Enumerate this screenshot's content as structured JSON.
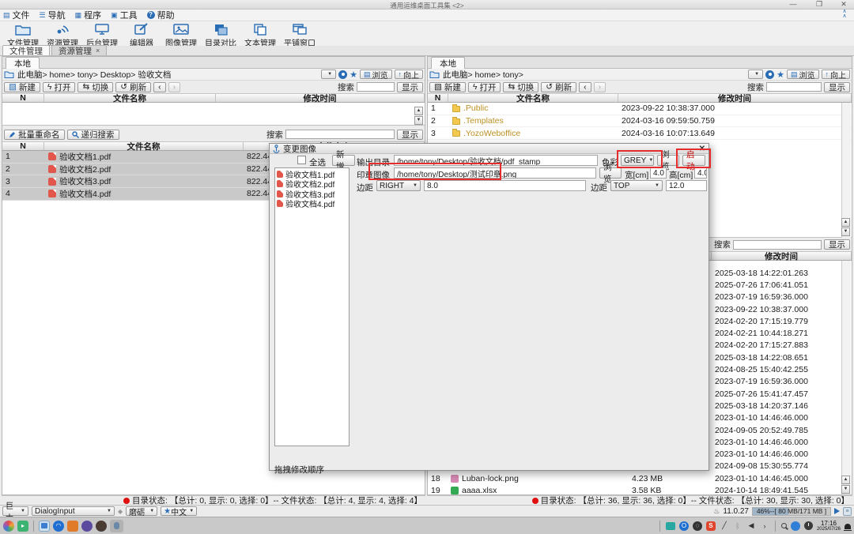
{
  "window": {
    "title": "通用运维桌面工具集 <2>"
  },
  "menu": {
    "file": "文件",
    "nav": "导航",
    "program": "程序",
    "tools": "工具",
    "help": "帮助"
  },
  "main_toolbar": {
    "file_mgmt": "文件管理",
    "resource_mgmt": "资源管理",
    "backend_mgmt": "后台管理",
    "editor": "编辑器",
    "image_mgmt": "图像管理",
    "dir_compare": "目录对比",
    "text_mgmt": "文本管理",
    "tile_windows": "平铺窗口"
  },
  "tabs": {
    "file_mgmt": "文件管理",
    "resource_mgmt": "资源管理"
  },
  "common": {
    "local_tab": "本地",
    "new": "新建",
    "open": "打开",
    "switch": "切换",
    "refresh": "刷新",
    "browse": "浏览",
    "up": "向上",
    "search": "搜索",
    "show": "显示",
    "col_n": "N",
    "col_name": "文件名称",
    "col_mtime": "修改时间",
    "col_size": "文件大小"
  },
  "left_pane": {
    "breadcrumb": "此电脑> home> tony> Desktop> 验收文档",
    "batch_rename": "批量重命名",
    "recursive_search": "递归搜索",
    "files": [
      {
        "n": "1",
        "name": "验收文档1.pdf",
        "size": "822.44 KB",
        "icon": "pdf"
      },
      {
        "n": "2",
        "name": "验收文档2.pdf",
        "size": "822.44 KB",
        "icon": "pdf"
      },
      {
        "n": "3",
        "name": "验收文档3.pdf",
        "size": "822.44 KB",
        "icon": "pdf"
      },
      {
        "n": "4",
        "name": "验收文档4.pdf",
        "size": "822.44 KB",
        "icon": "pdf"
      }
    ],
    "status": "目录状态: 【总计: 0, 显示: 0, 选择: 0】-- 文件状态: 【总计: 4, 显示: 4, 选择: 4】"
  },
  "right_pane": {
    "breadcrumb": "此电脑> home> tony>",
    "folders": [
      {
        "n": "1",
        "name": ".Public",
        "time": "2023-09-22 10:38:37.000",
        "icon": "folder"
      },
      {
        "n": "2",
        "name": ".Templates",
        "time": "2024-03-16 09:59:50.759",
        "icon": "folder"
      },
      {
        "n": "3",
        "name": ".YozoWeboffice",
        "time": "2024-03-16 10:07:13.649",
        "icon": "folder"
      }
    ],
    "bottom_rows": [
      {
        "time": "2025-03-18 14:22:01.263"
      },
      {
        "time": "2025-07-26 17:06:41.051"
      },
      {
        "time": "2023-07-19 16:59:36.000"
      },
      {
        "time": "2023-09-22 10:38:37.000"
      },
      {
        "time": "2024-02-20 17:15:19.779"
      },
      {
        "time": "2024-02-21 10:44:18.271"
      },
      {
        "time": "2024-02-20 17:15:27.883"
      },
      {
        "time": "2025-03-18 14:22:08.651"
      },
      {
        "time": "2024-08-25 15:40:42.255"
      },
      {
        "time": "2023-07-19 16:59:36.000"
      },
      {
        "time": "2025-07-26 15:41:47.457"
      },
      {
        "time": "2025-03-18 14:20:37.146"
      },
      {
        "time": "2023-01-10 14:46:46.000"
      },
      {
        "time": "2024-09-05 20:52:49.785"
      },
      {
        "time": "2023-01-10 14:46:46.000"
      },
      {
        "time": "2023-01-10 14:46:46.000"
      },
      {
        "time": "2024-09-08 15:30:55.774"
      },
      {
        "n": "18",
        "name": "Luban-lock.png",
        "size": "4.23 MB",
        "time": "2023-01-10 14:46:45.000",
        "icon": "png"
      },
      {
        "n": "19",
        "name": "aaaa.xlsx",
        "size": "3.58 KB",
        "time": "2024-10-14 18:49:41.545",
        "icon": "xlsx"
      }
    ],
    "status": "目录状态: 【总计: 36, 显示: 36, 选择: 0】-- 文件状态: 【总计: 30, 显示: 30, 选择: 0】"
  },
  "dialog": {
    "title": "变更图像",
    "select_all": "全选",
    "add": "新增",
    "files": [
      "验收文档1.pdf",
      "验收文档2.pdf",
      "验收文档3.pdf",
      "验收文档4.pdf"
    ],
    "output_dir_label": "输出目录",
    "output_dir": "/home/tony/Desktop/验收文档/pdf_stamp",
    "color_label": "色彩",
    "color_value": "GREY",
    "browse": "浏览",
    "start": "启动",
    "stamp_label": "印章图像",
    "stamp_path": "/home/tony/Desktop/测试印章.png",
    "width_label": "宽[cm]",
    "width_value": "4.0",
    "height_label": "高[cm]",
    "height_value": "4.0",
    "margin_label1": "边距",
    "margin_side1": "RIGHT",
    "margin_value1": "8.0",
    "margin_label2": "边距",
    "margin_side2": "TOP",
    "margin_value2": "12.0",
    "drag_hint": "拖拽修改顺序"
  },
  "bottom_bar": {
    "size": "巨大",
    "font": "DialogInput",
    "theme": "磨砺",
    "lang": "中文",
    "java_version": "11.0.27",
    "memory": "46%--[ 80 MB/171 MB ]",
    "memory_pct": 46
  },
  "taskbar": {
    "time": "17:16",
    "date": "2025/07/26"
  },
  "colors": {
    "accent": "#2a6db5",
    "annotation": "#e62d2d",
    "folder_text": "#bb9022",
    "start_text": "#c00000",
    "status_dot": "#e01010"
  }
}
